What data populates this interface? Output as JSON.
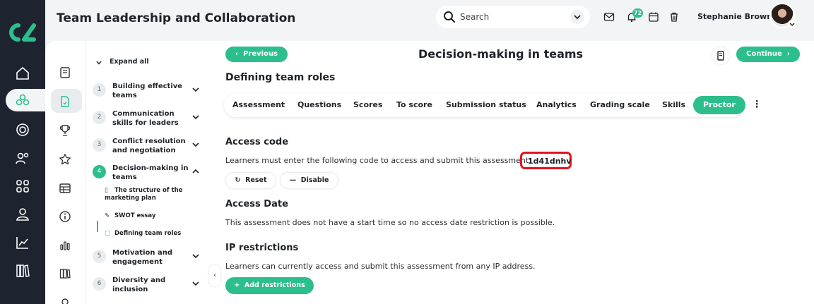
{
  "app": {
    "title": "Team Leadership and Collaboration",
    "brand_color": "#2dbe8d",
    "rail_color": "#1d2430"
  },
  "search": {
    "placeholder": "Search"
  },
  "notifications": {
    "badge": "72"
  },
  "user": {
    "name": "Stephanie Brown"
  },
  "rail": {
    "icons": [
      "home-icon",
      "courses-icon",
      "target-icon",
      "users-icon",
      "apps-icon",
      "profile-icon",
      "analytics-icon",
      "library-icon"
    ],
    "active": "courses-icon"
  },
  "icon_column": {
    "icons": [
      "book-icon",
      "document-icon",
      "trophy-icon",
      "star-icon",
      "table-icon",
      "info-icon",
      "bar-chart-icon",
      "books-icon",
      "circle-icon"
    ],
    "active": "document-icon"
  },
  "tree": {
    "expand_label": "Expand all",
    "nodes": [
      {
        "num": "1",
        "label": "Building effective teams"
      },
      {
        "num": "2",
        "label": "Communication skills for leaders"
      },
      {
        "num": "3",
        "label": "Conflict resolution and negotiation"
      },
      {
        "num": "4",
        "label": "Decision-making in teams"
      },
      {
        "num": "5",
        "label": "Motivation and engagement"
      },
      {
        "num": "6",
        "label": "Diversity and inclusion"
      }
    ],
    "subitems": [
      {
        "label": "The structure of the marketing plan",
        "icon": "document-icon"
      },
      {
        "label": "SWOT essay",
        "icon": "pencil-icon"
      },
      {
        "label": "Defining team roles",
        "icon": "assessment-icon"
      }
    ]
  },
  "main": {
    "prev_label": "Previous",
    "next_label": "Continue",
    "lesson_title": "Decision-making in teams",
    "section_title": "Defining team roles",
    "tabs": [
      "Assessment",
      "Questions",
      "Scores",
      "To score",
      "Submission status",
      "Analytics",
      "Grading scale",
      "Skills",
      "Proctor"
    ],
    "active_tab": "Proctor",
    "access_code": {
      "heading": "Access code",
      "text": "Learners must enter the following code to access and submit this assessment:",
      "code": "1d41dnhv",
      "reset_label": "Reset",
      "disable_label": "Disable"
    },
    "access_date": {
      "heading": "Access Date",
      "text": "This assessment does not have a start time so no access date restriction is possible."
    },
    "ip": {
      "heading": "IP restrictions",
      "text": "Learners can currently access and submit this assessment from any IP address.",
      "add_label": "Add restrictions"
    }
  }
}
